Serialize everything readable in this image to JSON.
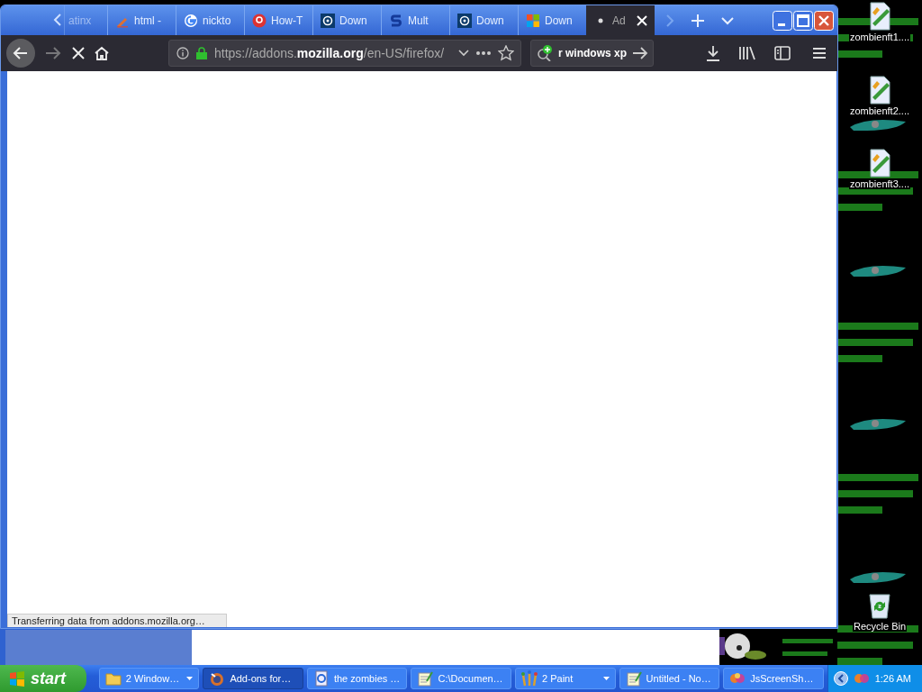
{
  "browser": {
    "tabs": [
      {
        "kind": "plain",
        "title": "atinx",
        "selected": false
      },
      {
        "kind": "pencil",
        "title": "html -",
        "selected": false
      },
      {
        "kind": "google",
        "title": "nickto",
        "selected": false
      },
      {
        "kind": "g-circle",
        "title": "How-T",
        "selected": false
      },
      {
        "kind": "target",
        "title": "Down",
        "selected": false
      },
      {
        "kind": "s-logo",
        "title": "Mult",
        "selected": false
      },
      {
        "kind": "target",
        "title": "Down",
        "selected": false
      },
      {
        "kind": "windows",
        "title": "Down",
        "selected": false
      },
      {
        "kind": "dot",
        "title": "Ad",
        "selected": true
      }
    ],
    "toolbar": {
      "forward_disabled": true,
      "url": "https://addons.**mozilla.org**/en-US/firefox/",
      "search": {
        "value": "r windows xp"
      }
    },
    "status_bar": "Transferring data from addons.mozilla.org…"
  },
  "desktop_icons": [
    {
      "kind": "paint-file",
      "label": "zombienft1...."
    },
    {
      "kind": "paint-file",
      "label": "zombienft2...."
    },
    {
      "kind": "paint-file",
      "label": "zombienft3...."
    },
    {
      "kind": "recycle-bin",
      "label": "Recycle Bin"
    }
  ],
  "taskbar": {
    "start": "start",
    "buttons": [
      {
        "kind": "folder",
        "label": "2 Window…",
        "grouped": true,
        "selected": false
      },
      {
        "kind": "firefox",
        "label": "Add-ons for…",
        "grouped": false,
        "selected": true
      },
      {
        "kind": "ie",
        "label": "the zombies …",
        "grouped": false,
        "selected": false
      },
      {
        "kind": "notepad",
        "label": "C:\\Documen…",
        "grouped": false,
        "selected": false
      },
      {
        "kind": "paint",
        "label": "2 Paint",
        "grouped": true,
        "selected": false
      },
      {
        "kind": "notepad",
        "label": "Untitled - No…",
        "grouped": false,
        "selected": false
      },
      {
        "kind": "js",
        "label": "JsScreenSh…",
        "grouped": false,
        "selected": false
      }
    ],
    "clock": "1:26 AM"
  }
}
